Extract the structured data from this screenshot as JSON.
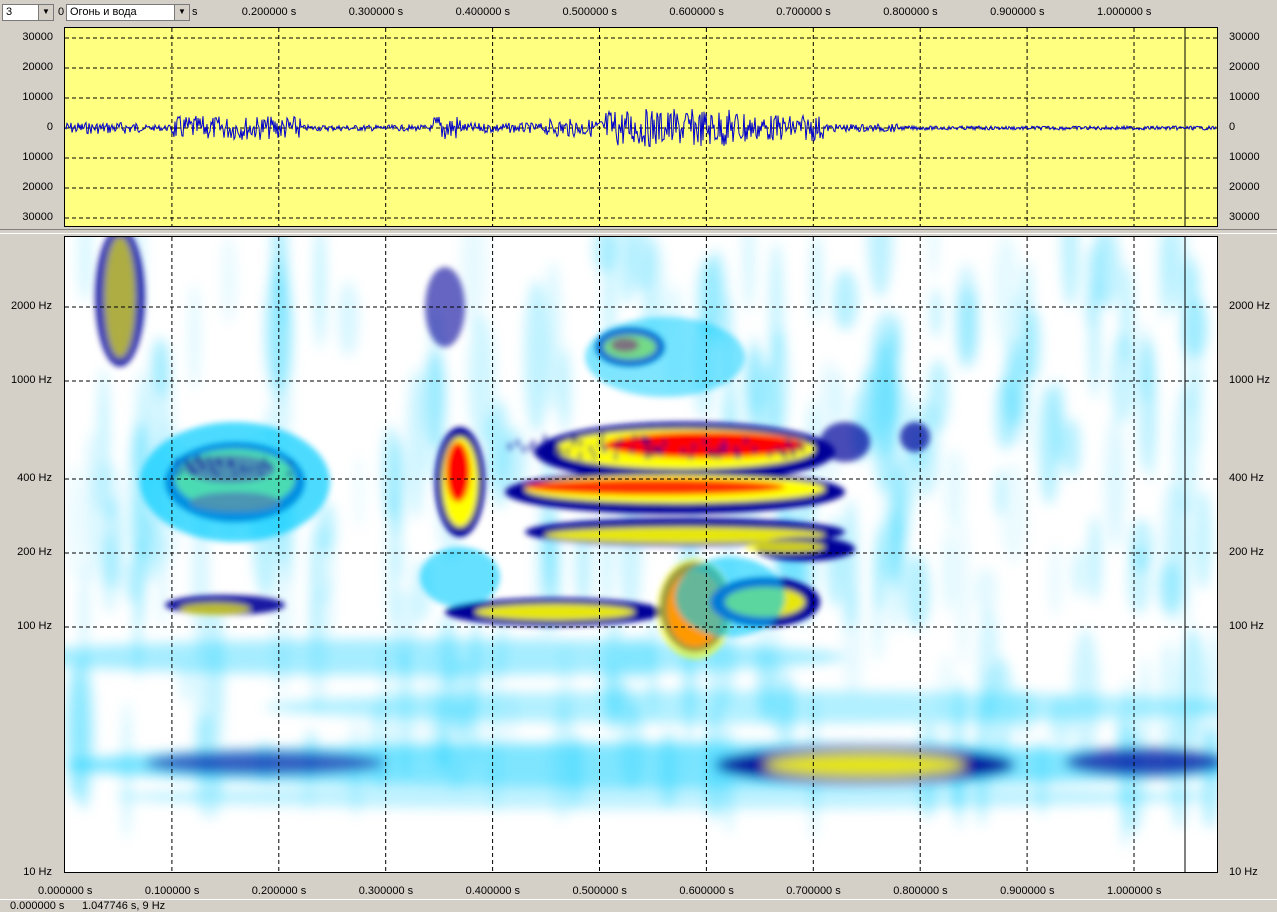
{
  "toolbar": {
    "channel_value": "3",
    "track_value": "Огонь и вода",
    "clipped_label": "0"
  },
  "time_axis": {
    "top_ticks": [
      "0.200000 s",
      "0.300000 s",
      "0.400000 s",
      "0.500000 s",
      "0.600000 s",
      "0.700000 s",
      "0.800000 s",
      "0.900000 s",
      "1.000000 s"
    ],
    "clipped_top_label": "s",
    "bottom_ticks": [
      "0.000000 s",
      "0.100000 s",
      "0.200000 s",
      "0.300000 s",
      "0.400000 s",
      "0.500000 s",
      "0.600000 s",
      "0.700000 s",
      "0.800000 s",
      "0.900000 s",
      "1.000000 s"
    ],
    "range_s": [
      0,
      1.08
    ]
  },
  "waveform": {
    "amplitude_labels": [
      "30000",
      "20000",
      "10000",
      "0",
      "10000",
      "20000",
      "30000"
    ],
    "background_color": "#ffff80",
    "trace_color": "#0000cc"
  },
  "spectrogram": {
    "freq_labels": [
      "2000 Hz",
      "1000 Hz",
      "400 Hz",
      "200 Hz",
      "100 Hz",
      "10 Hz"
    ],
    "colormap": [
      "#ffffff",
      "#00ccff",
      "#000099",
      "#ffff00",
      "#ff0000"
    ]
  },
  "status_bar": {
    "cursor_time": "0.000000 s",
    "position_info": "1.047746 s, 9 Hz"
  }
}
